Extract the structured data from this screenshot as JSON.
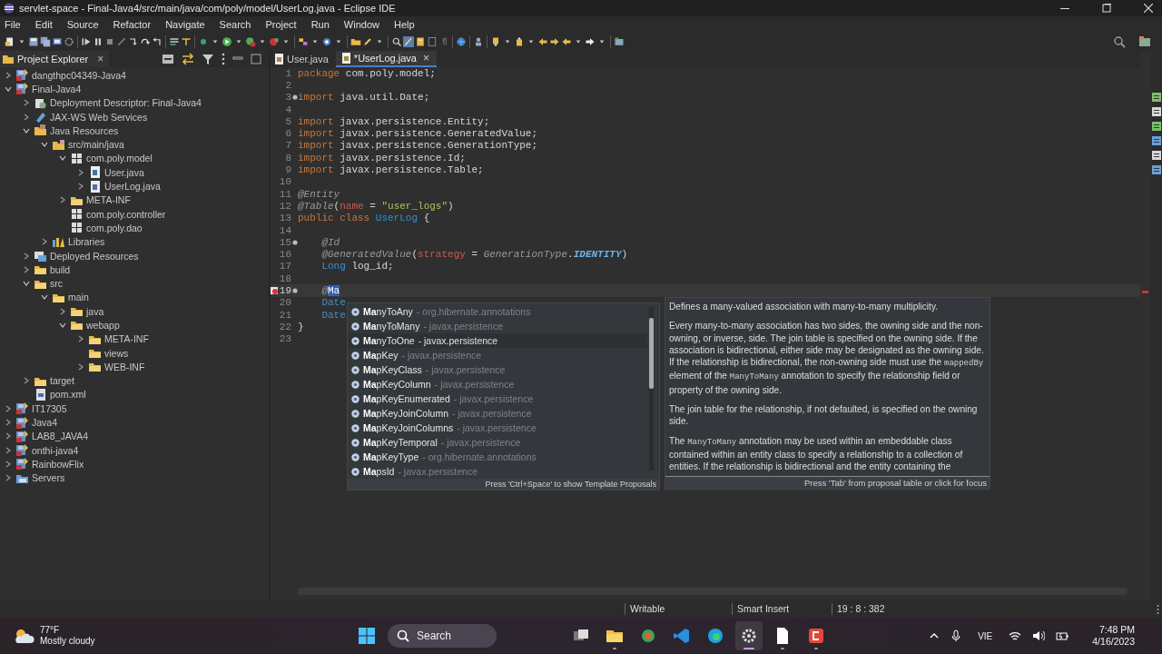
{
  "window": {
    "title": "servlet-space - Final-Java4/src/main/java/com/poly/model/UserLog.java - Eclipse IDE"
  },
  "menu": [
    "File",
    "Edit",
    "Source",
    "Refactor",
    "Navigate",
    "Search",
    "Project",
    "Run",
    "Window",
    "Help"
  ],
  "explorer": {
    "title": "Project Explorer",
    "close": "×",
    "tree": [
      {
        "label": "dangthpc04349-Java4",
        "kind": "project",
        "expanded": false
      },
      {
        "label": "Final-Java4",
        "kind": "project",
        "expanded": true,
        "children": [
          {
            "label": "Deployment Descriptor: Final-Java4",
            "kind": "descriptor",
            "expanded": false
          },
          {
            "label": "JAX-WS Web Services",
            "kind": "webservice",
            "expanded": false
          },
          {
            "label": "Java Resources",
            "kind": "resources",
            "expanded": true,
            "children": [
              {
                "label": "src/main/java",
                "kind": "srcfolder",
                "expanded": true,
                "children": [
                  {
                    "label": "com.poly.model",
                    "kind": "package",
                    "expanded": true,
                    "children": [
                      {
                        "label": "User.java",
                        "kind": "javafile",
                        "expanded": false
                      },
                      {
                        "label": "UserLog.java",
                        "kind": "javafile",
                        "expanded": false
                      }
                    ]
                  },
                  {
                    "label": "META-INF",
                    "kind": "folder",
                    "expanded": false
                  },
                  {
                    "label": "com.poly.controller",
                    "kind": "package"
                  },
                  {
                    "label": "com.poly.dao",
                    "kind": "package"
                  }
                ]
              },
              {
                "label": "Libraries",
                "kind": "library",
                "expanded": false
              }
            ]
          },
          {
            "label": "Deployed Resources",
            "kind": "deployed",
            "expanded": false
          },
          {
            "label": "build",
            "kind": "folder",
            "expanded": false
          },
          {
            "label": "src",
            "kind": "folder",
            "expanded": true,
            "children": [
              {
                "label": "main",
                "kind": "folder",
                "expanded": true,
                "children": [
                  {
                    "label": "java",
                    "kind": "folder",
                    "expanded": false
                  },
                  {
                    "label": "webapp",
                    "kind": "folder",
                    "expanded": true,
                    "children": [
                      {
                        "label": "META-INF",
                        "kind": "folder",
                        "expanded": false
                      },
                      {
                        "label": "views",
                        "kind": "folder"
                      },
                      {
                        "label": "WEB-INF",
                        "kind": "folder",
                        "expanded": false
                      }
                    ]
                  }
                ]
              }
            ]
          },
          {
            "label": "target",
            "kind": "folder",
            "expanded": false
          },
          {
            "label": "pom.xml",
            "kind": "xmlfile"
          }
        ]
      },
      {
        "label": "IT17305",
        "kind": "project",
        "expanded": false
      },
      {
        "label": "Java4",
        "kind": "project",
        "expanded": false
      },
      {
        "label": "LAB8_JAVA4",
        "kind": "project",
        "expanded": false
      },
      {
        "label": "onthi-java4",
        "kind": "project",
        "expanded": false
      },
      {
        "label": "RainbowFlix",
        "kind": "project",
        "expanded": false
      },
      {
        "label": "Servers",
        "kind": "servers",
        "expanded": false
      }
    ]
  },
  "editor_tabs": [
    {
      "label": "User.java",
      "selected": false
    },
    {
      "label": "*UserLog.java",
      "selected": true,
      "close": "×"
    }
  ],
  "code": {
    "lines": [
      {
        "number": "1",
        "current": false,
        "tokens": [
          {
            "text": "package",
            "kind": "kw"
          },
          {
            "text": " com.poly.model;",
            "kind": "plain"
          }
        ]
      },
      {
        "number": "2",
        "current": false
      },
      {
        "number": "3",
        "current": false,
        "markers": [
          {
            "kind": "fold"
          }
        ],
        "tokens": [
          {
            "text": "import",
            "kind": "kw"
          },
          {
            "text": " java.util.Date;",
            "kind": "plain"
          }
        ]
      },
      {
        "number": "4",
        "current": false
      },
      {
        "number": "5",
        "current": false,
        "tokens": [
          {
            "text": "import",
            "kind": "kw"
          },
          {
            "text": " javax.persistence.Entity;",
            "kind": "plain"
          }
        ]
      },
      {
        "number": "6",
        "current": false,
        "tokens": [
          {
            "text": "import",
            "kind": "kw"
          },
          {
            "text": " javax.persistence.GeneratedValue;",
            "kind": "plain"
          }
        ]
      },
      {
        "number": "7",
        "current": false,
        "tokens": [
          {
            "text": "import",
            "kind": "kw"
          },
          {
            "text": " javax.persistence.GenerationType;",
            "kind": "plain"
          }
        ]
      },
      {
        "number": "8",
        "current": false,
        "tokens": [
          {
            "text": "import",
            "kind": "kw"
          },
          {
            "text": " javax.persistence.Id;",
            "kind": "plain"
          }
        ]
      },
      {
        "number": "9",
        "current": false,
        "tokens": [
          {
            "text": "import",
            "kind": "kw"
          },
          {
            "text": " javax.persistence.Table;",
            "kind": "plain"
          }
        ]
      },
      {
        "number": "10",
        "current": false
      },
      {
        "number": "11",
        "current": false,
        "tokens": [
          {
            "text": "@Entity",
            "kind": "ann"
          }
        ]
      },
      {
        "number": "12",
        "current": false,
        "tokens": [
          {
            "text": "@Table",
            "kind": "ann"
          },
          {
            "text": "(",
            "kind": "plain"
          },
          {
            "text": "name",
            "kind": "attr"
          },
          {
            "text": " = ",
            "kind": "plain"
          },
          {
            "text": "\"user_logs\"",
            "kind": "str"
          },
          {
            "text": ")",
            "kind": "plain"
          }
        ]
      },
      {
        "number": "13",
        "current": false,
        "tokens": [
          {
            "text": "public class",
            "kind": "kw"
          },
          {
            "text": " UserLog",
            "kind": "cls"
          },
          {
            "text": " {",
            "kind": "plain"
          }
        ]
      },
      {
        "number": "14",
        "current": false
      },
      {
        "number": "15",
        "current": false,
        "markers": [
          {
            "kind": "fold"
          }
        ],
        "tokens": [
          {
            "text": "    @Id",
            "kind": "ann"
          }
        ]
      },
      {
        "number": "16",
        "current": false,
        "tokens": [
          {
            "text": "    @GeneratedValue",
            "kind": "ann"
          },
          {
            "text": "(",
            "kind": "plain"
          },
          {
            "text": "strategy",
            "kind": "attr"
          },
          {
            "text": " = ",
            "kind": "plain"
          },
          {
            "text": "GenerationType",
            "kind": "ann"
          },
          {
            "text": ".",
            "kind": "plain"
          },
          {
            "text": "IDENTITY",
            "kind": "const"
          },
          {
            "text": ")",
            "kind": "plain"
          }
        ]
      },
      {
        "number": "17",
        "current": false,
        "tokens": [
          {
            "text": "    Long",
            "kind": "type"
          },
          {
            "text": " log_id;",
            "kind": "plain"
          }
        ]
      },
      {
        "number": "18",
        "current": false
      },
      {
        "number": "19",
        "current": true,
        "markers": [
          {
            "kind": "error"
          },
          {
            "kind": "fold"
          }
        ],
        "tokens": [
          {
            "text": "    @",
            "kind": "ann"
          },
          {
            "text": "Ma",
            "kind": "selection"
          }
        ]
      },
      {
        "number": "20",
        "current": false,
        "tokens": [
          {
            "text": "    Date",
            "kind": "type"
          }
        ]
      },
      {
        "number": "21",
        "current": false,
        "tokens": [
          {
            "text": "    Date",
            "kind": "type"
          }
        ]
      },
      {
        "number": "22",
        "current": false,
        "tokens": [
          {
            "text": "}",
            "kind": "plain"
          }
        ]
      },
      {
        "number": "23",
        "current": false
      }
    ]
  },
  "proposals": {
    "items": [
      {
        "name": "**Ma**nyToAny",
        "package": "- org.hibernate.annotations",
        "selected": false
      },
      {
        "name": "**Ma**nyToMany",
        "package": "- javax.persistence",
        "selected": false
      },
      {
        "name": "**Ma**nyToOne",
        "package": "- javax.persistence",
        "selected": true
      },
      {
        "name": "**Ma**pKey",
        "package": "- javax.persistence",
        "selected": false
      },
      {
        "name": "**Ma**pKeyClass",
        "package": "- javax.persistence",
        "selected": false
      },
      {
        "name": "**Ma**pKeyColumn",
        "package": "- javax.persistence",
        "selected": false
      },
      {
        "name": "**Ma**pKeyEnumerated",
        "package": "- javax.persistence",
        "selected": false
      },
      {
        "name": "**Ma**pKeyJoinColumn",
        "package": "- javax.persistence",
        "selected": false
      },
      {
        "name": "**Ma**pKeyJoinColumns",
        "package": "- javax.persistence",
        "selected": false
      },
      {
        "name": "**Ma**pKeyTemporal",
        "package": "- javax.persistence",
        "selected": false
      },
      {
        "name": "**Ma**pKeyType",
        "package": "- org.hibernate.annotations",
        "selected": false
      },
      {
        "name": "**Ma**psId",
        "package": "- javax.persistence",
        "selected": false
      }
    ],
    "footer": "Press 'Ctrl+Space' to show Template Proposals"
  },
  "documentation": {
    "paragraphs": [
      [
        {
          "text": "Defines a many-valued association with many-to-many multiplicity.",
          "kind": "prose"
        }
      ],
      [
        {
          "text": "Every many-to-many association has two sides, the owning side and the non-owning, or inverse, side. The join table is specified on the owning side. If the association is bidirectional, either side may be designated as the owning side. If the relationship is bidirectional, the non-owning side must use the ",
          "kind": "prose"
        },
        {
          "text": "mappedBy",
          "kind": "code"
        },
        {
          "text": " element of the ",
          "kind": "prose"
        },
        {
          "text": "ManyToMany",
          "kind": "code"
        },
        {
          "text": " annotation to specify the relationship field or property of the owning side.",
          "kind": "prose"
        }
      ],
      [
        {
          "text": "The join table for the relationship, if not defaulted, is specified on the owning side.",
          "kind": "prose"
        }
      ],
      [
        {
          "text": "The ",
          "kind": "prose"
        },
        {
          "text": "ManyToMany",
          "kind": "code"
        },
        {
          "text": " annotation may be used within an embeddable class contained within an entity class to specify a relationship to a collection of entities. If the relationship is bidirectional and the entity containing the",
          "kind": "prose"
        }
      ]
    ],
    "footer": "Press 'Tab' from proposal table or click for focus"
  },
  "status_bar": [
    "Writable",
    "Smart Insert",
    "19 : 8 : 382"
  ],
  "taskbar": {
    "temperature": "77°F",
    "weather": "Mostly cloudy",
    "search": "Search",
    "language": "VIE",
    "time": "7:48 PM",
    "date": "4/16/2023"
  }
}
